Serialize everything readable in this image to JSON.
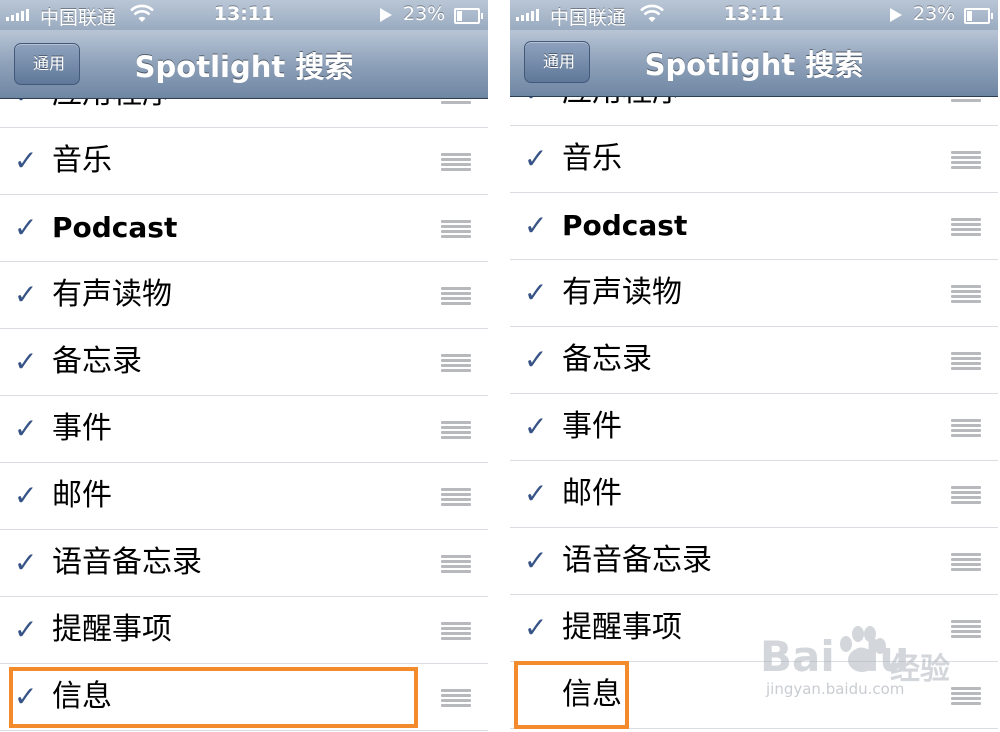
{
  "status_bar": {
    "carrier": "中国联通",
    "time": "13:11",
    "battery": "23%"
  },
  "nav": {
    "back_label": "通用",
    "title": "Spotlight 搜索"
  },
  "left_screen": {
    "items": [
      {
        "label": "应用程序",
        "checked": true
      },
      {
        "label": "音乐",
        "checked": true
      },
      {
        "label": "Podcast",
        "checked": true
      },
      {
        "label": "有声读物",
        "checked": true
      },
      {
        "label": "备忘录",
        "checked": true
      },
      {
        "label": "事件",
        "checked": true
      },
      {
        "label": "邮件",
        "checked": true
      },
      {
        "label": "语音备忘录",
        "checked": true
      },
      {
        "label": "提醒事项",
        "checked": true
      },
      {
        "label": "信息",
        "checked": true
      }
    ]
  },
  "right_screen": {
    "items": [
      {
        "label": "应用程序",
        "checked": true
      },
      {
        "label": "音乐",
        "checked": true
      },
      {
        "label": "Podcast",
        "checked": true
      },
      {
        "label": "有声读物",
        "checked": true
      },
      {
        "label": "备忘录",
        "checked": true
      },
      {
        "label": "事件",
        "checked": true
      },
      {
        "label": "邮件",
        "checked": true
      },
      {
        "label": "语音备忘录",
        "checked": true
      },
      {
        "label": "提醒事项",
        "checked": true
      },
      {
        "label": "信息",
        "checked": false
      }
    ]
  },
  "check_glyph": "✓",
  "watermark": {
    "logo": "Bai  du",
    "jingyan": "经验",
    "url": "jingyan.baidu.com"
  },
  "colors": {
    "highlight": "#f38a2b",
    "check": "#385487",
    "nav_bar": "#8ea1b9"
  }
}
